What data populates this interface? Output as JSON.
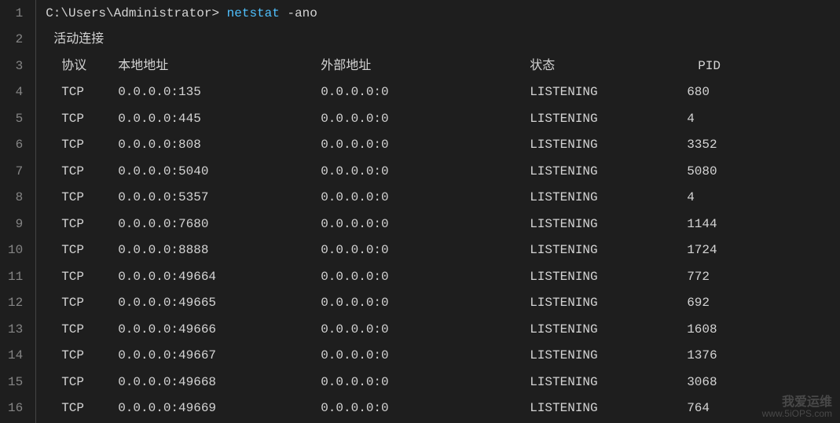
{
  "prompt": {
    "path": "C:\\Users\\Administrator> ",
    "command": "netstat",
    "args": " -ano"
  },
  "section_title": "活动连接",
  "headers": {
    "proto": "协议",
    "local": "本地地址",
    "foreign": "外部地址",
    "state": "状态",
    "pid": "PID"
  },
  "rows": [
    {
      "proto": "TCP",
      "local": "0.0.0.0:135",
      "foreign": "0.0.0.0:0",
      "state": "LISTENING",
      "pid": "680"
    },
    {
      "proto": "TCP",
      "local": "0.0.0.0:445",
      "foreign": "0.0.0.0:0",
      "state": "LISTENING",
      "pid": "4"
    },
    {
      "proto": "TCP",
      "local": "0.0.0.0:808",
      "foreign": "0.0.0.0:0",
      "state": "LISTENING",
      "pid": "3352"
    },
    {
      "proto": "TCP",
      "local": "0.0.0.0:5040",
      "foreign": "0.0.0.0:0",
      "state": "LISTENING",
      "pid": "5080"
    },
    {
      "proto": "TCP",
      "local": "0.0.0.0:5357",
      "foreign": "0.0.0.0:0",
      "state": "LISTENING",
      "pid": "4"
    },
    {
      "proto": "TCP",
      "local": "0.0.0.0:7680",
      "foreign": "0.0.0.0:0",
      "state": "LISTENING",
      "pid": "1144"
    },
    {
      "proto": "TCP",
      "local": "0.0.0.0:8888",
      "foreign": "0.0.0.0:0",
      "state": "LISTENING",
      "pid": "1724"
    },
    {
      "proto": "TCP",
      "local": "0.0.0.0:49664",
      "foreign": "0.0.0.0:0",
      "state": "LISTENING",
      "pid": "772"
    },
    {
      "proto": "TCP",
      "local": "0.0.0.0:49665",
      "foreign": "0.0.0.0:0",
      "state": "LISTENING",
      "pid": "692"
    },
    {
      "proto": "TCP",
      "local": "0.0.0.0:49666",
      "foreign": "0.0.0.0:0",
      "state": "LISTENING",
      "pid": "1608"
    },
    {
      "proto": "TCP",
      "local": "0.0.0.0:49667",
      "foreign": "0.0.0.0:0",
      "state": "LISTENING",
      "pid": "1376"
    },
    {
      "proto": "TCP",
      "local": "0.0.0.0:49668",
      "foreign": "0.0.0.0:0",
      "state": "LISTENING",
      "pid": "3068"
    },
    {
      "proto": "TCP",
      "local": "0.0.0.0:49669",
      "foreign": "0.0.0.0:0",
      "state": "LISTENING",
      "pid": "764"
    }
  ],
  "line_numbers": [
    "1",
    "2",
    "3",
    "4",
    "5",
    "6",
    "7",
    "8",
    "9",
    "10",
    "11",
    "12",
    "13",
    "14",
    "15",
    "16"
  ],
  "watermark": {
    "title": "我爱运维",
    "url": "www.5iOPS.com"
  }
}
